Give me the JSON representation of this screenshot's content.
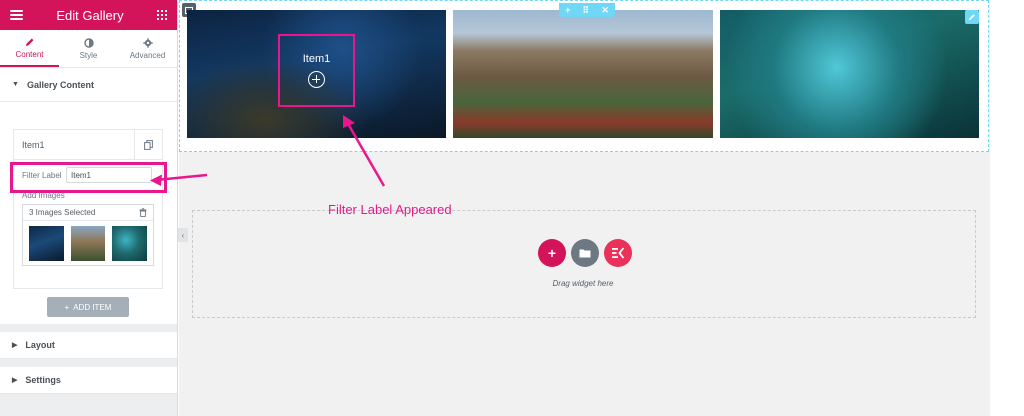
{
  "panel": {
    "title": "Edit Gallery",
    "tabs": [
      {
        "label": "Content",
        "icon": "pencil-icon",
        "active": true
      },
      {
        "label": "Style",
        "icon": "half-circle-icon",
        "active": false
      },
      {
        "label": "Advanced",
        "icon": "gear-icon",
        "active": false
      }
    ],
    "sections": {
      "gallery_content": "Gallery Content",
      "layout": "Layout",
      "settings": "Settings"
    },
    "item": {
      "title": "Item1",
      "filter_label_caption": "Filter Label",
      "filter_label_value": "Item1",
      "add_images_caption": "Add Images",
      "images_selected": "3 Images Selected"
    },
    "add_item_button": "ADD ITEM"
  },
  "preview": {
    "hover_label": "Item1",
    "drop_text": "Drag widget here",
    "controls": {
      "add": "+",
      "move": "⠿",
      "close": "✕"
    }
  },
  "annotation": {
    "text": "Filter Label Appeared",
    "color": "#e9178d"
  },
  "colors": {
    "brand": "#d4145a",
    "editor_accent": "#71d7f7",
    "annotation": "#e9178d"
  }
}
